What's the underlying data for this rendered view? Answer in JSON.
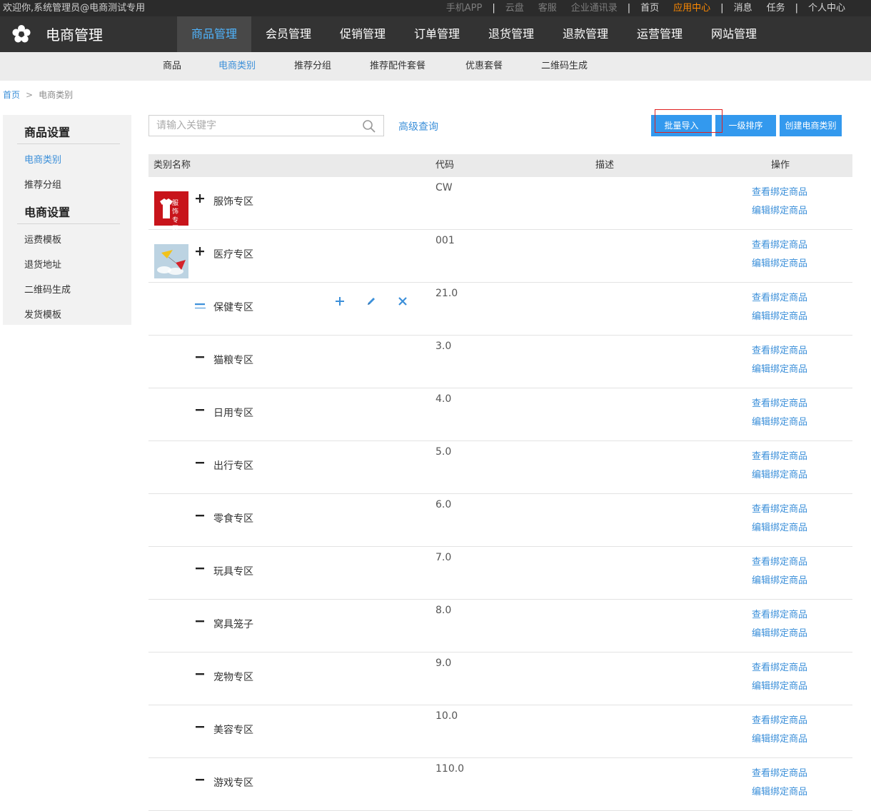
{
  "topbar": {
    "welcome": "欢迎你,系统管理员@电商测试专用",
    "links": [
      {
        "label": "手机APP",
        "style": "dim"
      },
      {
        "sep": "|"
      },
      {
        "label": "云盘",
        "style": "dim"
      },
      {
        "label": "客服",
        "style": "dim"
      },
      {
        "label": "企业通讯录",
        "style": "dim"
      },
      {
        "sep": "|"
      },
      {
        "label": "首页",
        "style": "bright"
      },
      {
        "label": "应用中心",
        "style": "orange"
      },
      {
        "sep": "|"
      },
      {
        "label": "消息",
        "style": "bright"
      },
      {
        "label": "任务",
        "style": "bright"
      },
      {
        "sep": "|"
      },
      {
        "label": "个人中心",
        "style": "bright"
      }
    ]
  },
  "header": {
    "app_title": "电商管理",
    "nav": [
      "商品管理",
      "会员管理",
      "促销管理",
      "订单管理",
      "退货管理",
      "退款管理",
      "运营管理",
      "网站管理"
    ],
    "active_nav": 0
  },
  "subnav": {
    "items": [
      "商品",
      "电商类别",
      "推荐分组",
      "推荐配件套餐",
      "优惠套餐",
      "二维码生成"
    ],
    "active": 1
  },
  "breadcrumb": {
    "home": "首页",
    "sep": ">",
    "current": "电商类别"
  },
  "sidebar": {
    "group1": "商品设置",
    "group1_items": [
      "电商类别",
      "推荐分组"
    ],
    "group2": "电商设置",
    "group2_items": [
      "运费模板",
      "退货地址",
      "二维码生成",
      "发货模板"
    ],
    "active": "电商类别"
  },
  "toolbar": {
    "search_placeholder": "请输入关键字",
    "advanced": "高级查询",
    "buttons": [
      "批量导入",
      "一级排序",
      "创建电商类别"
    ]
  },
  "table": {
    "headers": [
      "类别名称",
      "代码",
      "描述",
      "操作"
    ],
    "op_view": "查看绑定商品",
    "op_edit": "编辑绑定商品",
    "rows": [
      {
        "name": "服饰专区",
        "code": "CW",
        "toggle": "plus",
        "thumb": "clothing",
        "thumb_text": "服饰专区"
      },
      {
        "name": "医疗专区",
        "code": "001",
        "toggle": "plus",
        "thumb": "medical"
      },
      {
        "name": "保健专区",
        "code": "21.0",
        "toggle": "minus-active",
        "hover_actions": true
      },
      {
        "name": "猫粮专区",
        "code": "3.0",
        "toggle": "minus"
      },
      {
        "name": "日用专区",
        "code": "4.0",
        "toggle": "minus"
      },
      {
        "name": "出行专区",
        "code": "5.0",
        "toggle": "minus"
      },
      {
        "name": "零食专区",
        "code": "6.0",
        "toggle": "minus"
      },
      {
        "name": "玩具专区",
        "code": "7.0",
        "toggle": "minus"
      },
      {
        "name": "窝具笼子",
        "code": "8.0",
        "toggle": "minus"
      },
      {
        "name": "宠物专区",
        "code": "9.0",
        "toggle": "minus"
      },
      {
        "name": "美容专区",
        "code": "10.0",
        "toggle": "minus"
      },
      {
        "name": "游戏专区",
        "code": "110.0",
        "toggle": "minus"
      }
    ]
  },
  "colors": {
    "accent": "#3b8fd9",
    "button": "#3399ee",
    "header": "#333333",
    "topbar": "#2b2b2b",
    "highlight": "#ff8a00",
    "annotation": "#e02020"
  }
}
